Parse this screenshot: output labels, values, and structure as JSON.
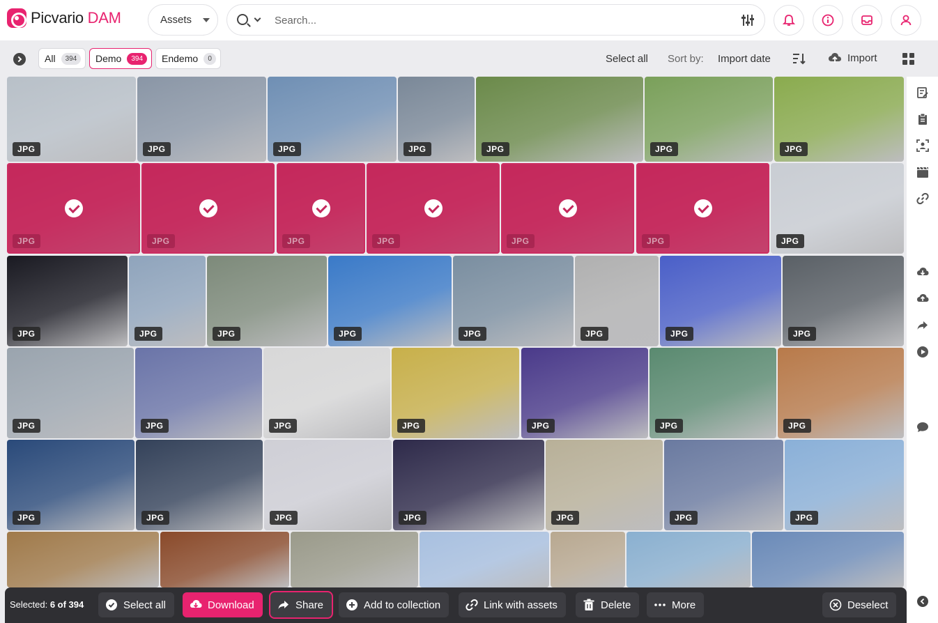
{
  "app": {
    "brand_main": "Picvario",
    "brand_accent": "DAM",
    "accent_color": "#e8236f"
  },
  "header": {
    "scope_select": "Assets",
    "search": {
      "placeholder": "Search..."
    },
    "icons": [
      "search-icon",
      "filter-sliders-icon",
      "bell-icon",
      "info-icon",
      "inbox-icon",
      "user-icon"
    ]
  },
  "toolbar": {
    "filters": [
      {
        "label": "All",
        "count": "394"
      },
      {
        "label": "Demo",
        "count": "394"
      },
      {
        "label": "Endemo",
        "count": "0"
      }
    ],
    "select_all": "Select all",
    "sort_label": "Sort by:",
    "sort_value": "Import date",
    "import_label": "Import"
  },
  "grid": {
    "badge": "JPG",
    "total": 43,
    "selected_count": 6,
    "tile_colors": [
      "#b8c0c8",
      "#8a96a6",
      "#6f8fb4",
      "#7a8898",
      "#6b8a4a",
      "#7aa05a",
      "#8aab4e",
      "#c4285c",
      "#c4285c",
      "#c4285c",
      "#c4285c",
      "#c4285c",
      "#c4285c",
      "#c9cdd3",
      "#1a1a22",
      "#8fa4bc",
      "#7d8a7a",
      "#3a7ac8",
      "#7a8ea0",
      "#b0b0b0",
      "#4a5fc8",
      "#5a6066",
      "#9aa4ae",
      "#6a74a8",
      "#d8d8d8",
      "#c8b04a",
      "#4a3a8a",
      "#5a8a70",
      "#b87a4a",
      "#2a4a7a",
      "#34425a",
      "#cfcfd6",
      "#2e2a4a",
      "#b8b098",
      "#6a7aa0",
      "#8ab0d8",
      "#a07a4a",
      "#8a4a2a",
      "#9a9a8a",
      "#a8c0e0",
      "#b8a890",
      "#8ab0d0",
      "#6a8ab8"
    ]
  },
  "actionbar": {
    "selected_prefix": "Selected:",
    "selected_value": "6 of 394",
    "select_all": "Select all",
    "download": "Download",
    "share": "Share",
    "add_to_collection": "Add to collection",
    "link_with_assets": "Link with assets",
    "delete": "Delete",
    "more": "More",
    "deselect": "Deselect"
  }
}
